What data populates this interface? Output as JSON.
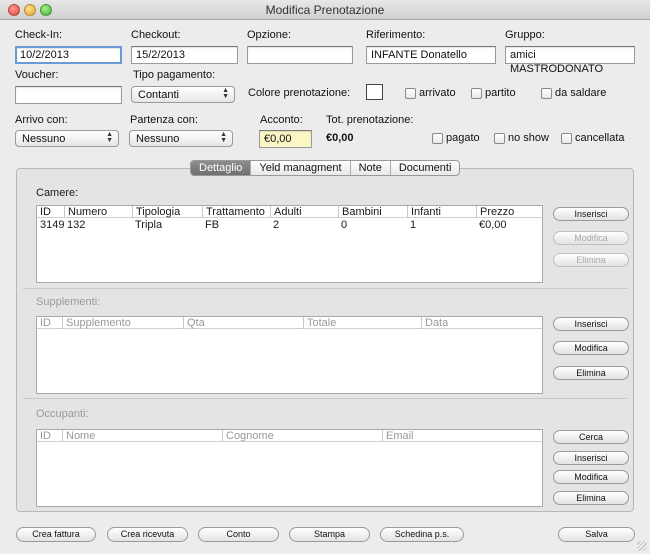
{
  "window": {
    "title": "Modifica Prenotazione"
  },
  "form": {
    "checkin_label": "Check-In:",
    "checkin_value": "10/2/2013",
    "checkout_label": "Checkout:",
    "checkout_value": "15/2/2013",
    "opzione_label": "Opzione:",
    "opzione_value": "",
    "riferimento_label": "Riferimento:",
    "riferimento_value": "INFANTE Donatello",
    "gruppo_label": "Gruppo:",
    "gruppo_value": "amici MASTRODONATO",
    "voucher_label": "Voucher:",
    "voucher_value": "",
    "tipo_pagamento_label": "Tipo pagamento:",
    "tipo_pagamento_value": "Contanti",
    "colore_label": "Colore prenotazione:",
    "arrivato_label": "arrivato",
    "partito_label": "partito",
    "da_saldare_label": "da saldare",
    "arrivo_label": "Arrivo con:",
    "arrivo_value": "Nessuno",
    "partenza_label": "Partenza con:",
    "partenza_value": "Nessuno",
    "acconto_label": "Acconto:",
    "acconto_value": "€0,00",
    "tot_label": "Tot. prenotazione:",
    "tot_value": "€0,00",
    "pagato_label": "pagato",
    "no_show_label": "no show",
    "cancellata_label": "cancellata"
  },
  "tabs": [
    "Dettaglio",
    "Yeld managment",
    "Note",
    "Documenti"
  ],
  "camere": {
    "label": "Camere:",
    "headers": [
      "ID",
      "Numero",
      "Tipologia",
      "Trattamento",
      "Adulti",
      "Bambini",
      "Infanti",
      "Prezzo"
    ],
    "rows": [
      [
        "3149",
        "132",
        "Tripla",
        "FB",
        "2",
        "0",
        "1",
        "€0,00"
      ]
    ],
    "buttons": [
      "Inserisci",
      "Modifica",
      "Elimina"
    ]
  },
  "supplementi": {
    "label": "Supplementi:",
    "headers": [
      "ID",
      "Supplemento",
      "Qta",
      "Totale",
      "Data"
    ],
    "buttons": [
      "Inserisci",
      "Modifica",
      "Elimina"
    ]
  },
  "occupanti": {
    "label": "Occupanti:",
    "headers": [
      "ID",
      "Nome",
      "Cognome",
      "Email"
    ],
    "buttons": [
      "Cerca",
      "Inserisci",
      "Modifica",
      "Elimina"
    ]
  },
  "footer": {
    "buttons": [
      "Crea fattura",
      "Crea ricevuta",
      "Conto",
      "Stampa",
      "Schedina p.s.",
      "Salva"
    ]
  }
}
